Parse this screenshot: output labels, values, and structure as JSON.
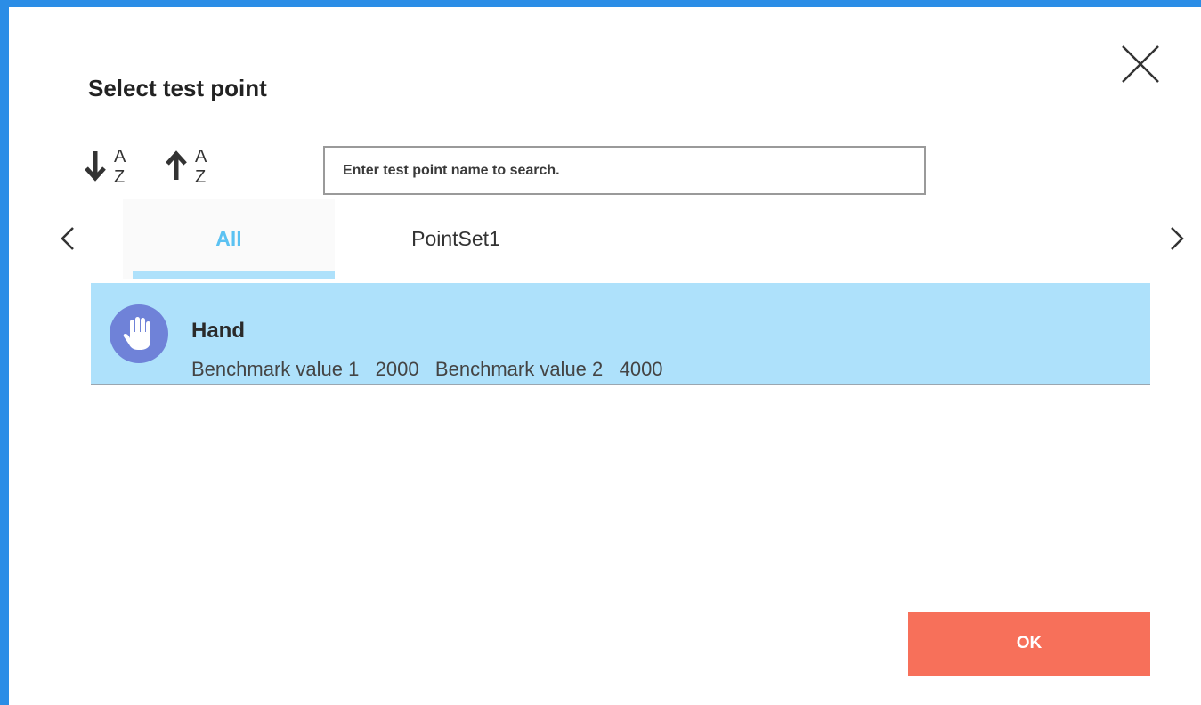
{
  "dialog": {
    "title": "Select test point",
    "close_icon": "close-icon",
    "border_color": "#2b8de6"
  },
  "toolbar": {
    "sort_ascending_icon": "sort-a-z-ascending-icon",
    "sort_descending_icon": "sort-a-z-descending-icon",
    "sort_letters": [
      "A",
      "Z"
    ]
  },
  "search": {
    "placeholder": "Enter test point name to search.",
    "value": ""
  },
  "tabs": [
    {
      "label": "All",
      "selected": true
    },
    {
      "label": "PointSet1",
      "selected": false
    }
  ],
  "nav": {
    "prev_icon": "chevron-left-icon",
    "next_icon": "chevron-right-icon"
  },
  "test_points": [
    {
      "name": "Hand",
      "icon": "hand-icon",
      "detail": "Benchmark value 1   2000   Benchmark value 2   4000",
      "selected": true
    }
  ],
  "actions": {
    "ok_label": "OK"
  },
  "colors": {
    "accent": "#5cc2f2",
    "selection": "#aee1fb",
    "ok_button": "#f7705a",
    "avatar": "#6f82d8"
  }
}
